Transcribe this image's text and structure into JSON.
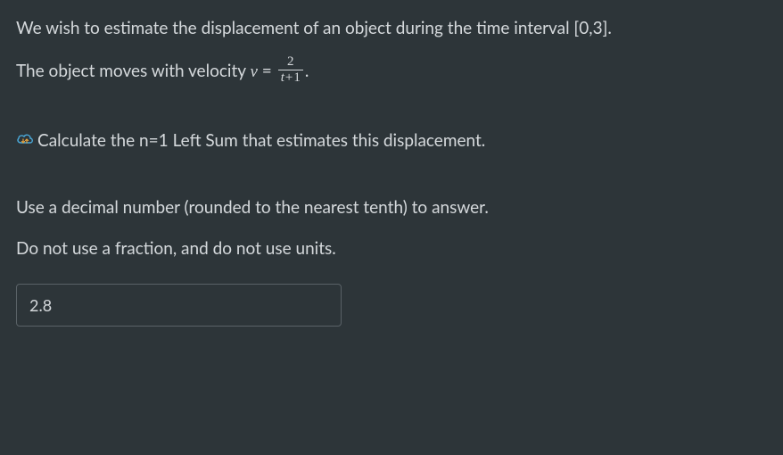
{
  "problem": {
    "line1": "We wish to estimate the displacement of an object during the time interval [0,3].",
    "line2_prefix": "The object moves with velocity ",
    "velocity_var": "v",
    "equals": " = ",
    "frac_num": "2",
    "frac_den_t": "t",
    "frac_den_plus": "+",
    "frac_den_one": "1",
    "line2_suffix": ".",
    "task": "Calculate the n=1 Left Sum that estimates this displacement.",
    "instruction1": "Use a decimal number (rounded to the nearest tenth) to answer.",
    "instruction2": "Do not use a fraction, and do not use units."
  },
  "answer": {
    "value": "2.8"
  }
}
